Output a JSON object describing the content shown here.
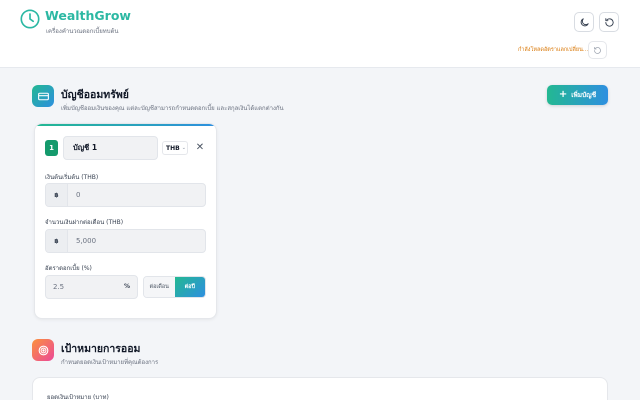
{
  "header": {
    "brand": "WealthGrow",
    "tagline": "เครื่องคำนวณดอกเบี้ยทบต้น",
    "rates_status": "กำลังโหลดอัตราแลกเปลี่ยน..."
  },
  "accounts_section": {
    "title": "บัญชีออมทรัพย์",
    "description": "เพิ่มบัญชีออมเงินของคุณ แต่ละบัญชีสามารถกำหนดดอกเบี้ย และสกุลเงินได้แตกต่างกัน",
    "add_button": "เพิ่มบัญชี"
  },
  "account": {
    "number": "1",
    "name": "บัญชี 1",
    "currency": "THB",
    "initial_label": "เงินต้นเริ่มต้น (THB)",
    "initial_prefix": "฿",
    "initial_value": "0",
    "monthly_label": "จำนวนเงินฝากต่อเดือน (THB)",
    "monthly_prefix": "฿",
    "monthly_value": "5,000",
    "rate_label": "อัตราดอกเบี้ย (%)",
    "rate_value": "2.5",
    "rate_unit": "%",
    "period_options": [
      "ต่อเดือน",
      "ต่อปี"
    ],
    "period_selected": "ต่อปี"
  },
  "goal_section": {
    "title": "เป้าหมายการออม",
    "description": "กำหนดยอดเงินเป้าหมายที่คุณต้องการ",
    "target_label": "ยอดเงินเป้าหมาย (บาท)"
  },
  "colors": {
    "brand": "#2cb8a3",
    "accent_start": "#23b892",
    "accent_end": "#2e8fe0",
    "warning": "#d97706"
  },
  "icons": {
    "logo": "clock-icon",
    "theme": "moon-icon",
    "reset": "refresh-icon",
    "accounts": "credit-card-icon",
    "goal": "target-icon"
  }
}
